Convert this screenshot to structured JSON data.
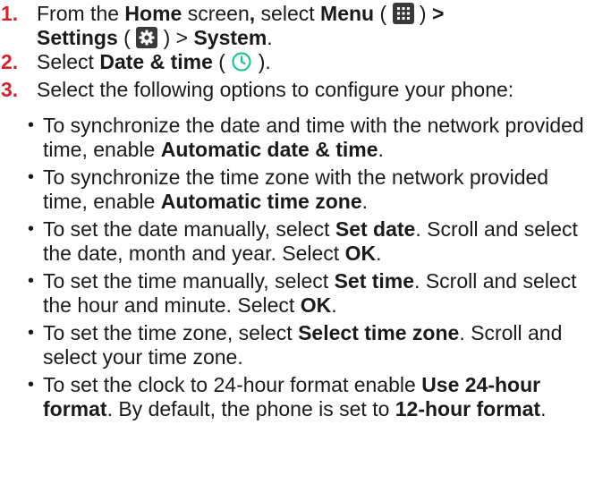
{
  "steps": [
    {
      "number": "1.",
      "t1": "From the ",
      "b1": "Home",
      "t2": " screen",
      "b2": ",",
      "t3": " select ",
      "b3": "Menu",
      "t4": " ( ",
      "t5": " ) ",
      "b4": ">",
      "b5": "Settings",
      "t6": " ( ",
      "t7": " ) > ",
      "b6": "System",
      "t8": "."
    },
    {
      "number": "2.",
      "t1": "Select ",
      "b1": "Date & time",
      "t2": " ( ",
      "t3": " )."
    },
    {
      "number": "3.",
      "text": "Select the following options to configure your phone:"
    }
  ],
  "bullet_glyph": "•",
  "bullets": [
    {
      "text": "To synchronize the date and time with the network provided time, enable ",
      "bold": "Automatic date & time",
      "after": "."
    },
    {
      "text": "To synchronize the time zone with the network provided time, enable ",
      "bold": "Automatic time zone",
      "after": "."
    },
    {
      "text": "To set the date manually, select ",
      "bold": "Set date",
      "after": ". Scroll and select the date, month and year. Select ",
      "bold2": "OK",
      "after2": "."
    },
    {
      "text": "To set the time manually, select ",
      "bold": "Set time",
      "after": ". Scroll and select the hour and minute. Select ",
      "bold2": "OK",
      "after2": "."
    },
    {
      "text": "To set the time zone, select ",
      "bold": "Select time zone",
      "after": ". Scroll and select your time zone."
    },
    {
      "text": "To set the clock to 24-hour format enable ",
      "bold": "Use 24-hour format",
      "after": ". By default, the phone is set to ",
      "bold2": "12-hour format",
      "after2": "."
    }
  ],
  "colors": {
    "step_number": "#d3242e",
    "clock_icon": "#1fc48e",
    "icon_box": "#3a3a3a",
    "text": "#1a1a1a"
  },
  "icons": {
    "menu": "grid-menu-icon",
    "settings": "gear-icon",
    "date_time": "clock-icon"
  }
}
